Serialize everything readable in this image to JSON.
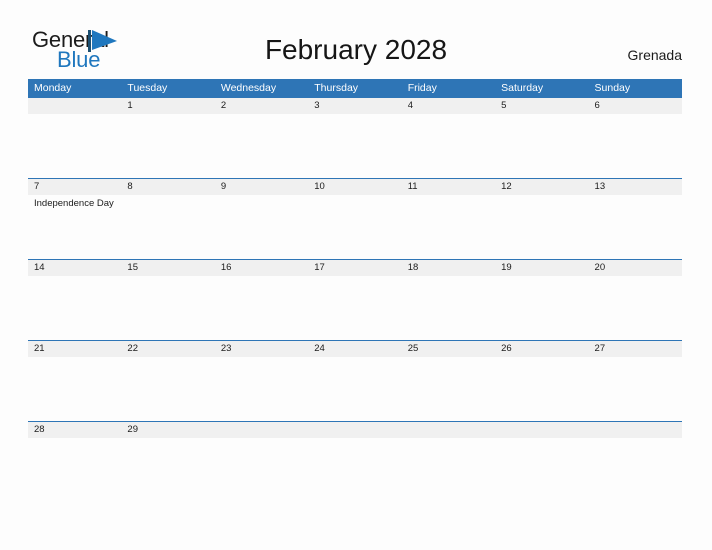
{
  "brand": {
    "name_part1": "General",
    "name_part2": "Blue",
    "flag_icon": "blue-triangle-flag-icon",
    "accent_color": "#1f77be"
  },
  "header": {
    "title": "February 2028",
    "country": "Grenada"
  },
  "calendar": {
    "header_color": "#2e75b6",
    "date_band_color": "#f0f0f0",
    "month": "February",
    "year": "2028",
    "weekday_headers": [
      "Monday",
      "Tuesday",
      "Wednesday",
      "Thursday",
      "Friday",
      "Saturday",
      "Sunday"
    ],
    "weeks": [
      {
        "days": [
          {
            "date": "",
            "event": ""
          },
          {
            "date": "1",
            "event": ""
          },
          {
            "date": "2",
            "event": ""
          },
          {
            "date": "3",
            "event": ""
          },
          {
            "date": "4",
            "event": ""
          },
          {
            "date": "5",
            "event": ""
          },
          {
            "date": "6",
            "event": ""
          }
        ]
      },
      {
        "days": [
          {
            "date": "7",
            "event": "Independence Day"
          },
          {
            "date": "8",
            "event": ""
          },
          {
            "date": "9",
            "event": ""
          },
          {
            "date": "10",
            "event": ""
          },
          {
            "date": "11",
            "event": ""
          },
          {
            "date": "12",
            "event": ""
          },
          {
            "date": "13",
            "event": ""
          }
        ]
      },
      {
        "days": [
          {
            "date": "14",
            "event": ""
          },
          {
            "date": "15",
            "event": ""
          },
          {
            "date": "16",
            "event": ""
          },
          {
            "date": "17",
            "event": ""
          },
          {
            "date": "18",
            "event": ""
          },
          {
            "date": "19",
            "event": ""
          },
          {
            "date": "20",
            "event": ""
          }
        ]
      },
      {
        "days": [
          {
            "date": "21",
            "event": ""
          },
          {
            "date": "22",
            "event": ""
          },
          {
            "date": "23",
            "event": ""
          },
          {
            "date": "24",
            "event": ""
          },
          {
            "date": "25",
            "event": ""
          },
          {
            "date": "26",
            "event": ""
          },
          {
            "date": "27",
            "event": ""
          }
        ]
      },
      {
        "days": [
          {
            "date": "28",
            "event": ""
          },
          {
            "date": "29",
            "event": ""
          },
          {
            "date": "",
            "event": ""
          },
          {
            "date": "",
            "event": ""
          },
          {
            "date": "",
            "event": ""
          },
          {
            "date": "",
            "event": ""
          },
          {
            "date": "",
            "event": ""
          }
        ]
      }
    ]
  }
}
